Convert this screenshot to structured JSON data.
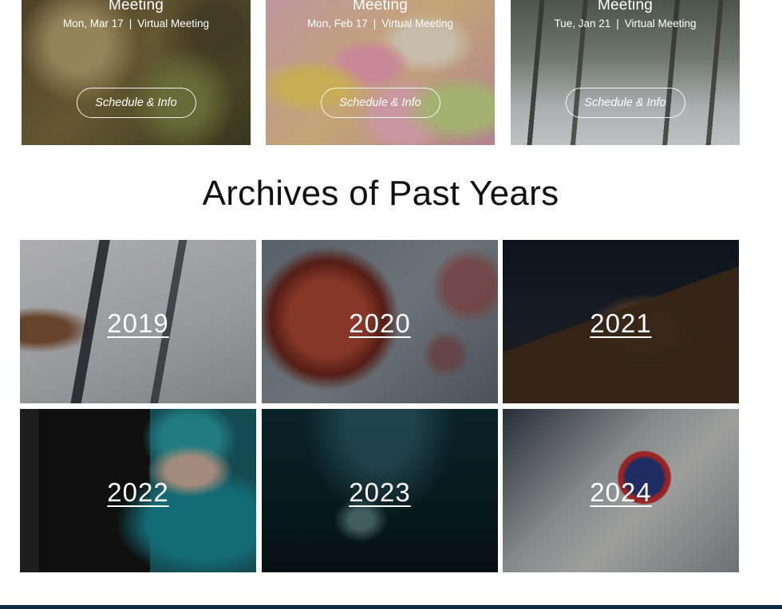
{
  "meetings": [
    {
      "title": "Meeting",
      "date": "Mon, Mar 17",
      "separator": "|",
      "type": "Virtual Meeting",
      "button_label": "Schedule & Info"
    },
    {
      "title": "Meeting",
      "date": "Mon, Feb 17",
      "separator": "|",
      "type": "Virtual Meeting",
      "button_label": "Schedule & Info"
    },
    {
      "title": "Meeting",
      "date": "Tue, Jan 21",
      "separator": "|",
      "type": "Virtual Meeting",
      "button_label": "Schedule & Info"
    }
  ],
  "archives": {
    "title": "Archives of Past Years",
    "years": [
      {
        "label": "2019"
      },
      {
        "label": "2020"
      },
      {
        "label": "2021"
      },
      {
        "label": "2022"
      },
      {
        "label": "2023"
      },
      {
        "label": "2024"
      }
    ]
  },
  "colors": {
    "footer_bar": "#0f2a44",
    "title_text": "#111111"
  }
}
